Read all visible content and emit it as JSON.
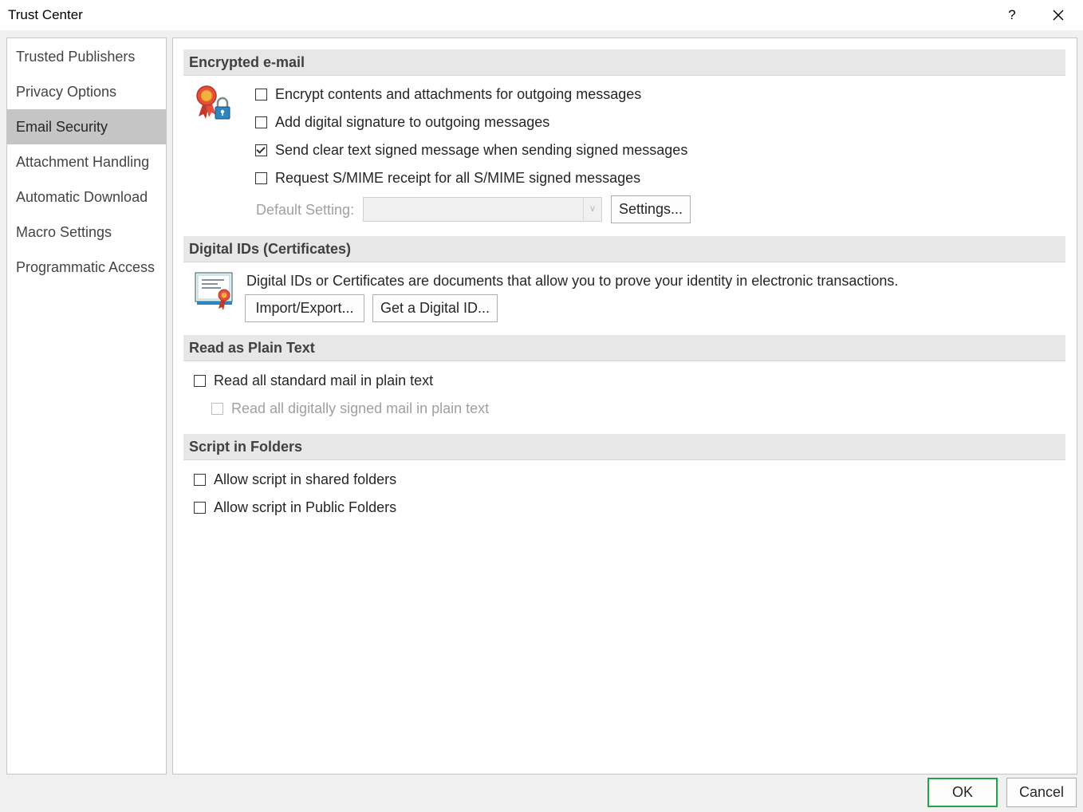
{
  "window": {
    "title": "Trust Center",
    "help_label": "?",
    "close_label": "✕"
  },
  "nav": {
    "items": [
      {
        "label": "Trusted Publishers"
      },
      {
        "label": "Privacy Options"
      },
      {
        "label": "Email Security"
      },
      {
        "label": "Attachment Handling"
      },
      {
        "label": "Automatic Download"
      },
      {
        "label": "Macro Settings"
      },
      {
        "label": "Programmatic Access"
      }
    ],
    "selected": "Email Security"
  },
  "encrypted": {
    "header": "Encrypted e-mail",
    "options": [
      {
        "label": "Encrypt contents and attachments for outgoing messages",
        "checked": false
      },
      {
        "label": "Add digital signature to outgoing messages",
        "checked": false
      },
      {
        "label": "Send clear text signed message when sending signed messages",
        "checked": true
      },
      {
        "label": "Request S/MIME receipt for all S/MIME signed messages",
        "checked": false
      }
    ],
    "default_setting_label": "Default Setting:",
    "default_setting_value": "",
    "settings_button": "Settings..."
  },
  "digital_ids": {
    "header": "Digital IDs (Certificates)",
    "description": "Digital IDs or Certificates are documents that allow you to prove your identity in electronic transactions.",
    "import_export_button": "Import/Export...",
    "get_id_button": "Get a Digital ID..."
  },
  "plain_text": {
    "header": "Read as Plain Text",
    "read_all": {
      "label": "Read all standard mail in plain text",
      "checked": false
    },
    "read_signed": {
      "label": "Read all digitally signed mail in plain text",
      "checked": false,
      "disabled": true
    }
  },
  "script": {
    "header": "Script in Folders",
    "shared": {
      "label": "Allow script in shared folders",
      "checked": false
    },
    "public": {
      "label": "Allow script in Public Folders",
      "checked": false
    }
  },
  "footer": {
    "ok": "OK",
    "cancel": "Cancel"
  },
  "colors": {
    "ok_border": "#22a34b",
    "selected_nav": "#c5c5c5",
    "section_header_bg": "#e7e7e7"
  },
  "icons": [
    "help-icon",
    "close-icon",
    "certificate-lock-icon",
    "certificate-icon",
    "dropdown-arrow-icon",
    "checkbox-checked-icon"
  ]
}
